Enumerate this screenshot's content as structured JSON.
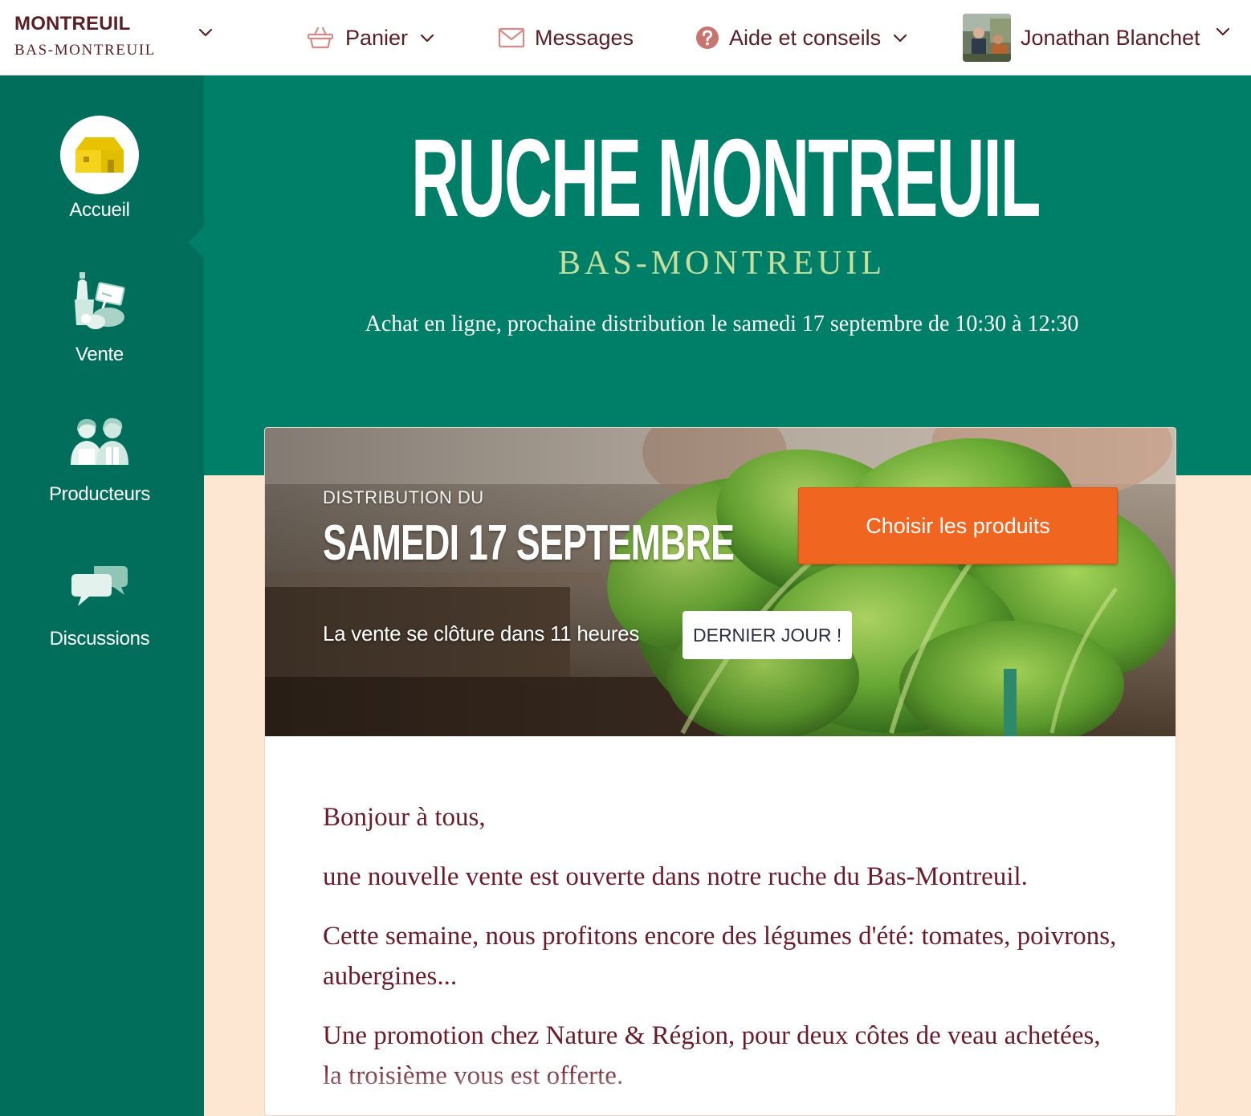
{
  "topbar": {
    "hive_city": "MONTREUIL",
    "hive_district": "BAS-MONTREUIL",
    "panier_label": "Panier",
    "messages_label": "Messages",
    "aide_label": "Aide et conseils",
    "user_name": "Jonathan Blanchet"
  },
  "sidebar": {
    "items": [
      {
        "label": "Accueil",
        "icon": "house-icon",
        "active": true
      },
      {
        "label": "Vente",
        "icon": "sale-items-icon",
        "active": false
      },
      {
        "label": "Producteurs",
        "icon": "producers-icon",
        "active": false
      },
      {
        "label": "Discussions",
        "icon": "chat-bubbles-icon",
        "active": false
      }
    ]
  },
  "hero": {
    "title": "RUCHE MONTREUIL",
    "subtitle": "BAS-MONTREUIL",
    "info": "Achat en ligne, prochaine distribution le samedi 17 septembre de 10:30 à 12:30"
  },
  "distribution": {
    "label": "DISTRIBUTION DU",
    "date": "SAMEDI 17 SEPTEMBRE",
    "closing_text": "La vente se clôture dans 11 heures",
    "badge": "DERNIER JOUR !",
    "cta_label": "Choisir les produits"
  },
  "message": {
    "paragraphs": [
      "Bonjour à tous,",
      "une nouvelle vente est ouverte dans notre ruche du Bas-Montreuil.",
      "Cette semaine, nous profitons encore des légumes d'été: tomates, poivrons, aubergines...",
      "Une promotion chez Nature & Région, pour deux côtes de veau achetées, la troisième vous est offerte."
    ]
  },
  "colors": {
    "sidebar": "#006e5a",
    "hero": "#007f68",
    "cream": "#fde6d2",
    "accent": "#f0651f",
    "brand_text": "#5a1e25",
    "message_text": "#6b1b2a",
    "subtitle": "#c7de9c"
  }
}
